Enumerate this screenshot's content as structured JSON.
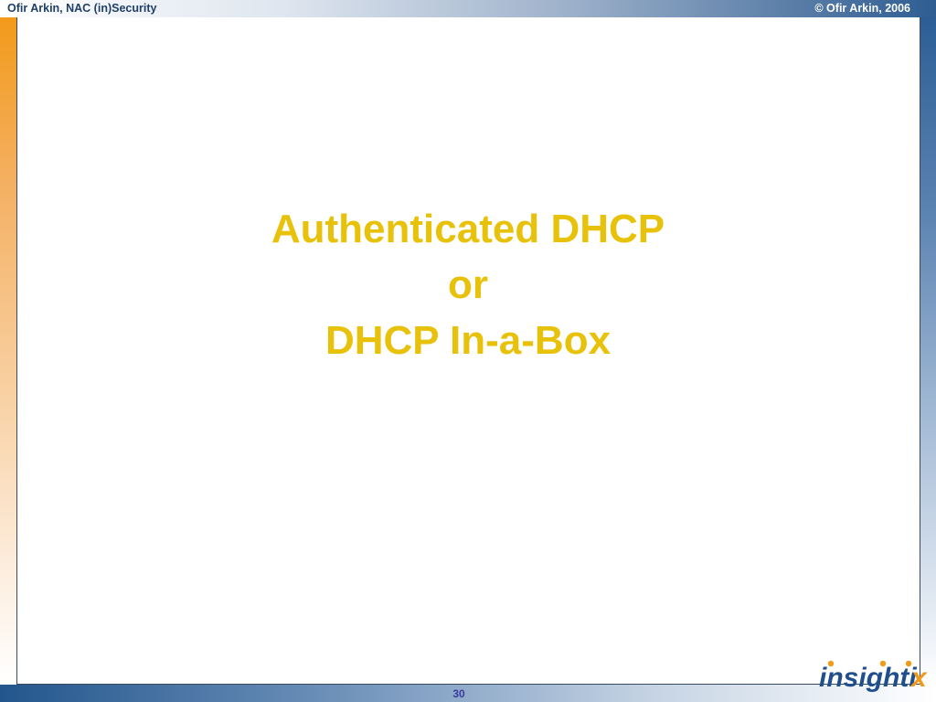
{
  "header": {
    "left_text": "Ofir Arkin, NAC (in)Security",
    "right_text": "© Ofir Arkin, 2006"
  },
  "slide": {
    "title_lines": [
      "Authenticated DHCP",
      "or",
      "DHCP In-a-Box"
    ]
  },
  "footer": {
    "page_number": "30",
    "logo_text": "insightix",
    "logo_text_main": "insighti",
    "logo_text_accent": "x"
  },
  "colors": {
    "title": "#e8c10a",
    "logo_main": "#1f4f8c",
    "logo_accent": "#f29a1a",
    "page_number": "#3a3aa0"
  }
}
